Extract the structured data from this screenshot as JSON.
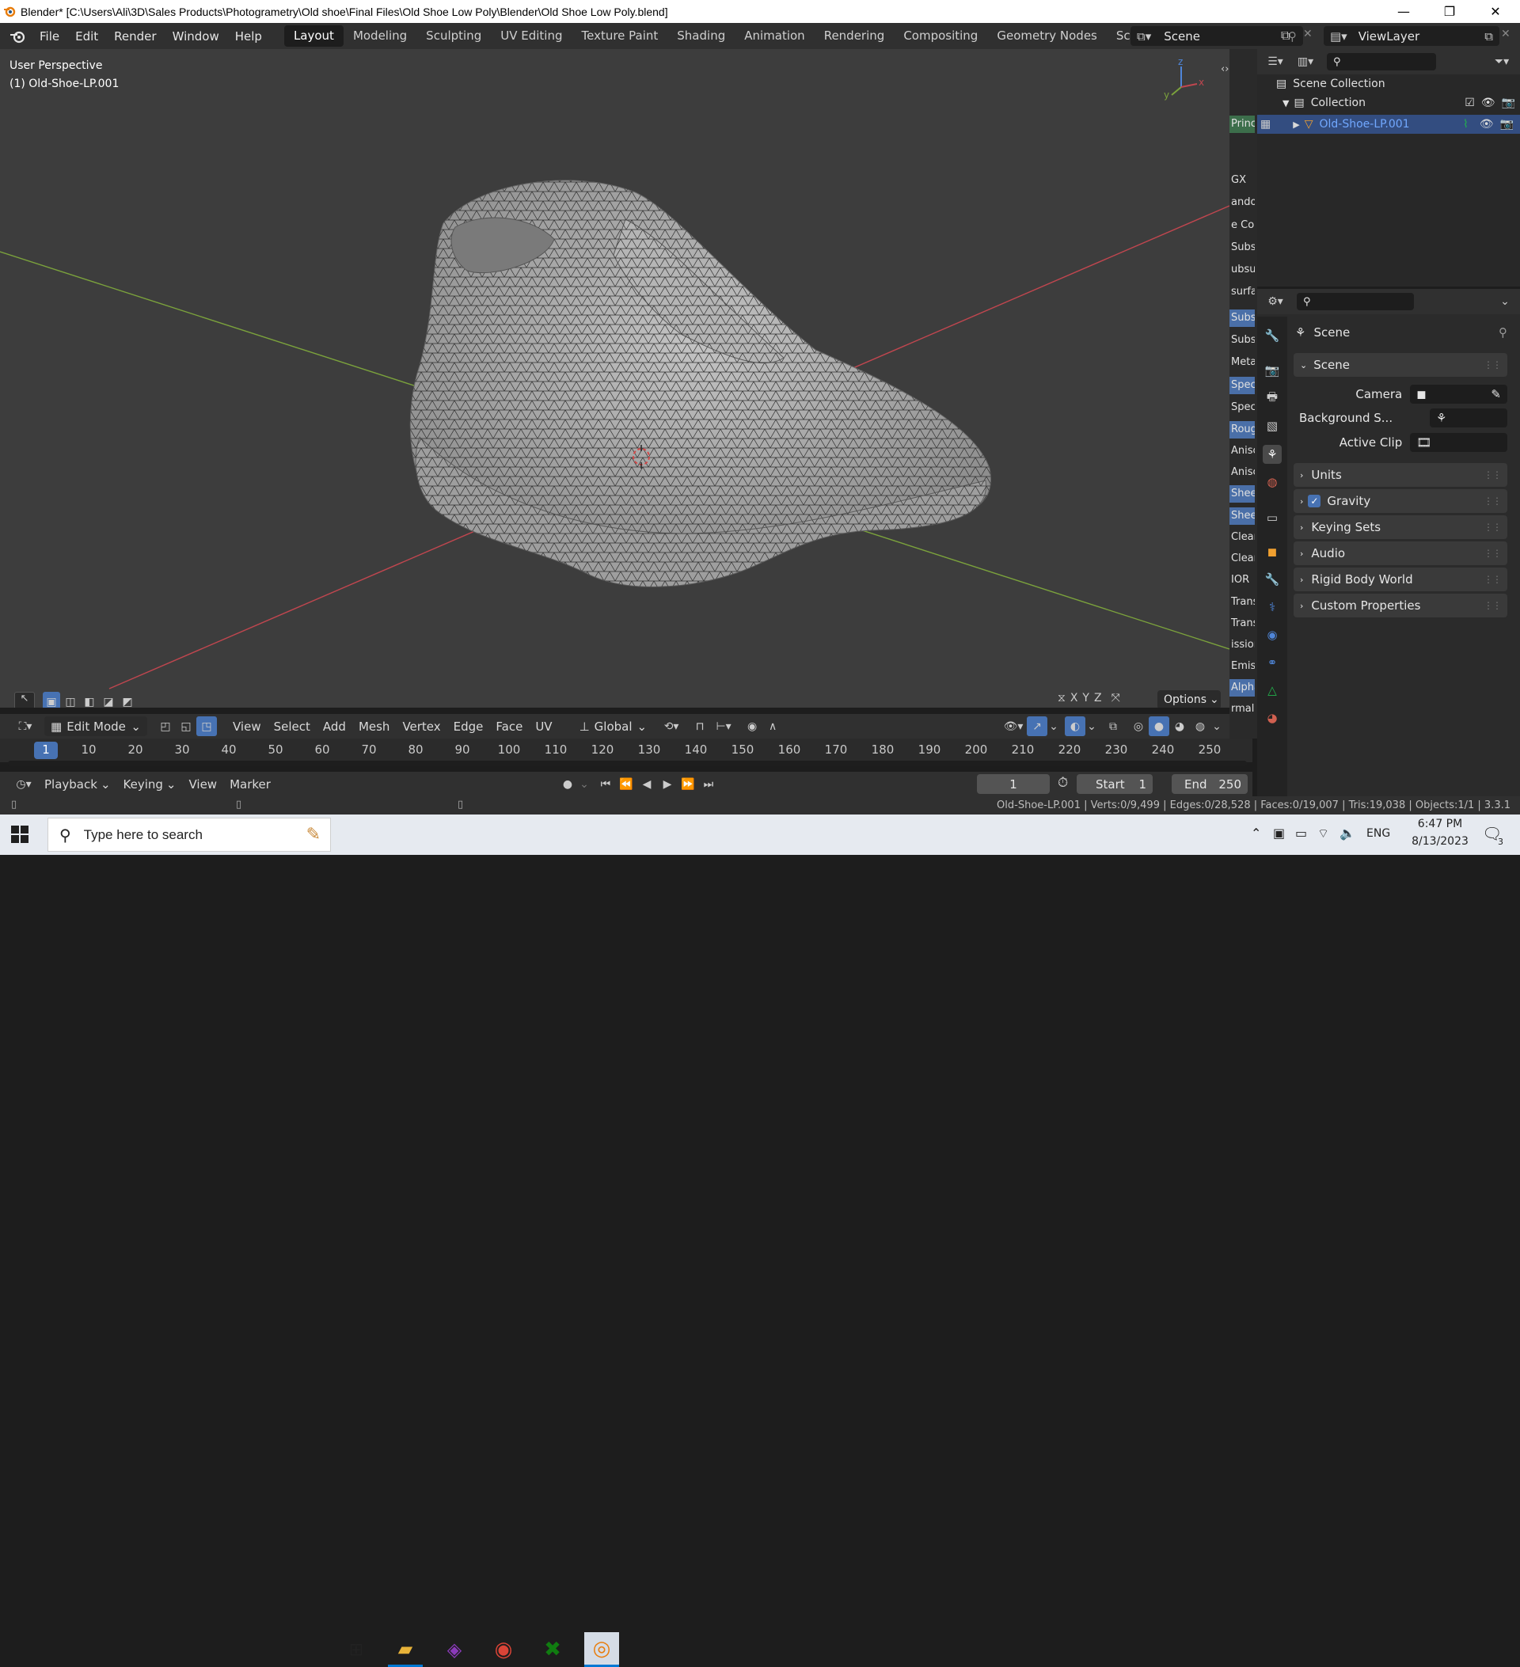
{
  "window": {
    "title": "Blender* [C:\\Users\\Ali\\3D\\Sales Products\\Photogrametry\\Old shoe\\Final Files\\Old Shoe Low Poly\\Blender\\Old Shoe Low Poly.blend]",
    "minimize": "—",
    "restore": "❐",
    "close": "✕"
  },
  "menu": {
    "items": [
      "File",
      "Edit",
      "Render",
      "Window",
      "Help"
    ],
    "workspaces": [
      "Layout",
      "Modeling",
      "Sculpting",
      "UV Editing",
      "Texture Paint",
      "Shading",
      "Animation",
      "Rendering",
      "Compositing",
      "Geometry Nodes",
      "Scripting"
    ],
    "add_workspace": "+",
    "scene_name": "Scene",
    "view_layer": "ViewLayer"
  },
  "viewport": {
    "perspective_label": "User Perspective",
    "object_label": "(1) Old-Shoe-LP.001",
    "gizmo_axes": [
      "z",
      "y",
      "x"
    ]
  },
  "viewport_header": {
    "mode": "Edit Mode",
    "menus": [
      "View",
      "Select",
      "Add",
      "Mesh",
      "Vertex",
      "Edge",
      "Face",
      "UV"
    ],
    "transform_orientation": "Global",
    "options_label": "Options",
    "axis_buttons": [
      "X",
      "Y",
      "Z"
    ]
  },
  "side_strip": {
    "items": [
      "Princi",
      "GX",
      "andor",
      "e Co",
      "Subs",
      "ubsur",
      "surfa",
      "Subs",
      "Subs",
      "Meta",
      "Spec",
      "Spec",
      "Roug",
      "Anisc",
      "Anisc",
      "Shee",
      "Shee",
      "Clear",
      "Clear",
      "IOR",
      "Trans",
      "Trans",
      "ission",
      "Emis",
      "Alpha",
      "rmal"
    ]
  },
  "outliner": {
    "scene_collection": "Scene Collection",
    "collection": "Collection",
    "object": "Old-Shoe-LP.001"
  },
  "properties": {
    "header": "Scene",
    "panel_scene": "Scene",
    "camera_label": "Camera",
    "background_label": "Background S...",
    "active_clip_label": "Active Clip",
    "panels": [
      "Units",
      "Gravity",
      "Keying Sets",
      "Audio",
      "Rigid Body World",
      "Custom Properties"
    ],
    "gravity_checked": true
  },
  "timeline": {
    "ticks": [
      1,
      10,
      20,
      30,
      40,
      50,
      60,
      70,
      80,
      90,
      100,
      110,
      120,
      130,
      140,
      150,
      160,
      170,
      180,
      190,
      200,
      210,
      220,
      230,
      240,
      250
    ],
    "current_frame": "1",
    "menus": [
      "Playback",
      "Keying",
      "View",
      "Marker"
    ],
    "frame_field": "1",
    "start_label": "Start",
    "start_value": "1",
    "end_label": "End",
    "end_value": "250"
  },
  "statusbar": {
    "stats": "Old-Shoe-LP.001 | Verts:0/9,499 | Edges:0/28,528 | Faces:0/19,007 | Tris:19,038 | Objects:1/1 | 3.3.1"
  },
  "taskbar": {
    "search_placeholder": "Type here to search",
    "language": "ENG",
    "time": "6:47 PM",
    "date": "8/13/2023",
    "notification_count": "3"
  },
  "colors": {
    "accent_blue": "#4772b3",
    "active_object_text": "#71a8ff",
    "x_axis": "#c0464f",
    "y_axis": "#7ba23c"
  }
}
